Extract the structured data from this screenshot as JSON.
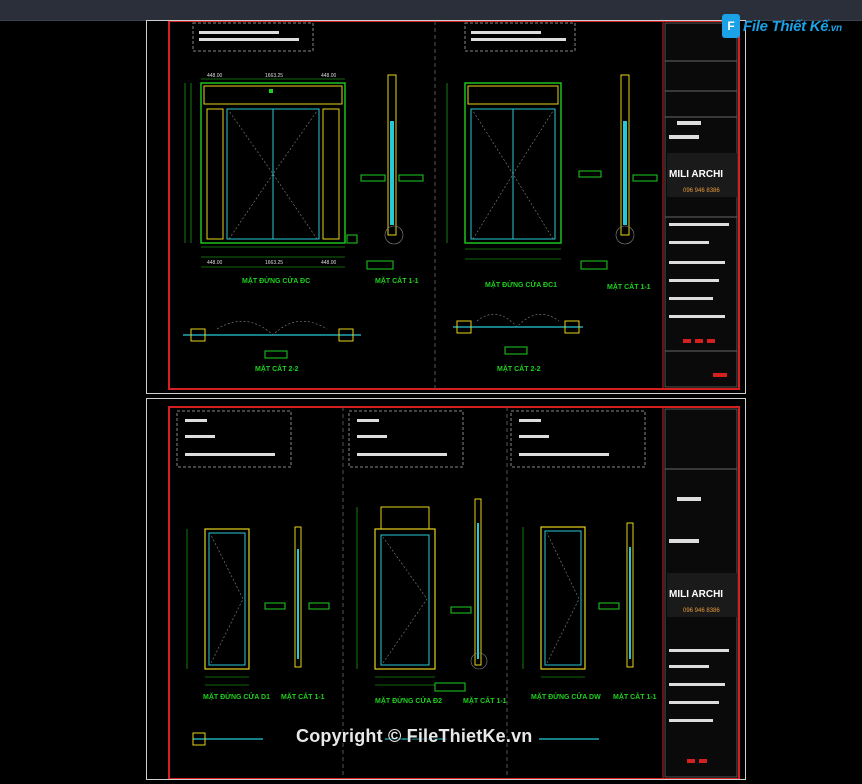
{
  "watermark": {
    "logo_letter": "F",
    "logo_text": "File Thiết Kế",
    "logo_suffix": ".vn",
    "copyright": "Copyright © FileThietKe.vn"
  },
  "sheet1": {
    "left_panel": {
      "top_dims": [
        "448.00",
        "1663.25",
        "448.00"
      ],
      "bottom_dims": [
        "448.00",
        "1663.25",
        "448.00"
      ],
      "elev_title": "MẶT ĐỨNG CỬA ĐC",
      "sect11_title": "MẶT CẮT 1-1",
      "sect22_title": "MẶT CẮT 2-2"
    },
    "right_panel": {
      "elev_title": "MẶT ĐỨNG CỬA ĐC1",
      "sect11_title": "MẶT CẮT 1-1",
      "sect22_title": "MẶT CẮT 2-2"
    }
  },
  "sheet2": {
    "p1": {
      "elev_title": "MẶT ĐỨNG CỬA D1",
      "sect_title": "MẶT CẮT 1-1"
    },
    "p2": {
      "elev_title": "MẶT ĐỨNG CỬA Đ2",
      "sect_title": "MẶT CẮT 1-1"
    },
    "p3": {
      "elev_title": "MẶT ĐỨNG CỬA DW",
      "sect_title": "MẶT CẮT 1-1"
    }
  },
  "title_block": {
    "brand": "MILI ARCHI",
    "phone": "096 946 8386"
  },
  "colors": {
    "frame_red": "#d42020",
    "cad_green": "#1ed11e",
    "cad_yellow": "#e6d21a",
    "cad_cyan": "#27c9d8",
    "title_bg": "#1a1a1a"
  }
}
